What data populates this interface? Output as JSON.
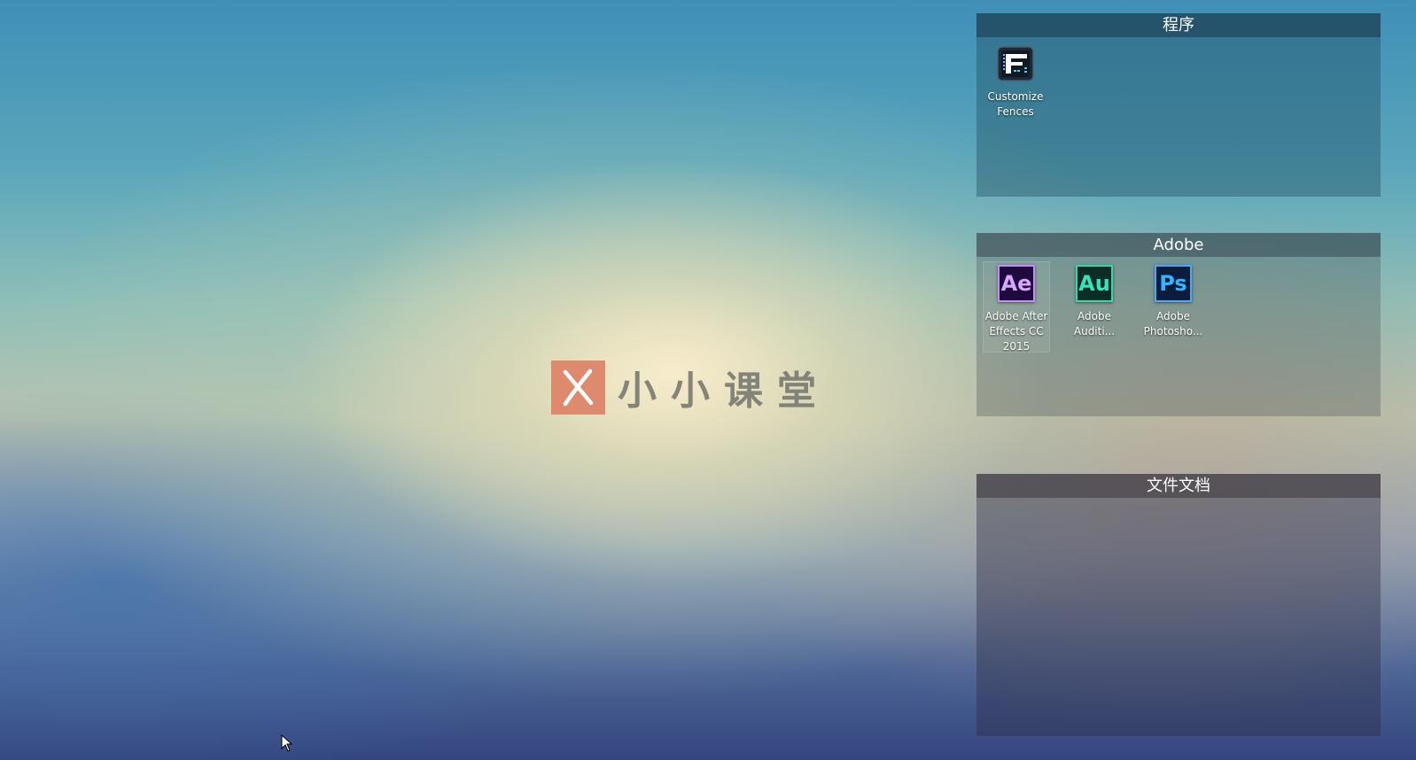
{
  "watermark": {
    "text": "小小课堂",
    "logo_color": "#de8a6e"
  },
  "fences": [
    {
      "title": "程序",
      "items": [
        {
          "label_lines": [
            "Customize",
            "Fences"
          ],
          "icon": "fences-app-icon"
        }
      ]
    },
    {
      "title": "Adobe",
      "items": [
        {
          "label_lines": [
            "Adobe After",
            "Effects CC",
            "2015"
          ],
          "icon": "after-effects-icon",
          "abbr": "Ae",
          "bg": "#1f0a3d",
          "fg": "#d8a6ff",
          "border": "#c88cf5"
        },
        {
          "label_lines": [
            "Adobe",
            "Auditi..."
          ],
          "icon": "audition-icon",
          "abbr": "Au",
          "bg": "#0a2d27",
          "fg": "#39e3b9",
          "border": "#39d6ad"
        },
        {
          "label_lines": [
            "Adobe",
            "Photosho..."
          ],
          "icon": "photoshop-icon",
          "abbr": "Ps",
          "bg": "#0b1c3d",
          "fg": "#36b3ff",
          "border": "#4aa8f5"
        }
      ]
    },
    {
      "title": "文件文档",
      "items": []
    }
  ]
}
